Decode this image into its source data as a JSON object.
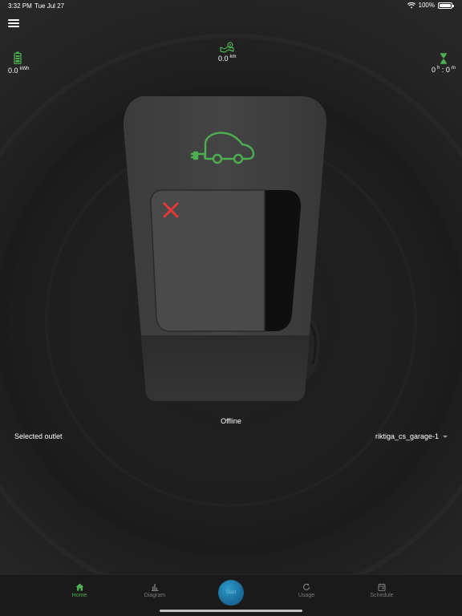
{
  "status_bar": {
    "time": "3:32 PM",
    "date": "Tue Jul 27",
    "battery_percent": "100%",
    "battery_level": 1.0
  },
  "stats": {
    "energy": {
      "value": "0.0",
      "unit": "kWh",
      "icon": "battery-icon"
    },
    "distance": {
      "value": "0.0",
      "unit": "km",
      "icon": "route-map-icon"
    },
    "time": {
      "hours": "0",
      "hours_unit": "h",
      "separator": ":",
      "minutes": "0",
      "minutes_unit": "m",
      "icon": "hourglass-icon"
    }
  },
  "charger": {
    "status": "Offline",
    "status_icon": "red-x-icon",
    "logo_icon": "ev-car-plug-icon"
  },
  "outlet": {
    "label": "Selected outlet",
    "selected": "riktiga_cs_garage-1"
  },
  "nav": {
    "home": "Home",
    "diagram": "Diagram",
    "start": "Start",
    "usage": "Usage",
    "schedule": "Schedule"
  },
  "colors": {
    "accent_green": "#4caf50",
    "error_red": "#e53935",
    "start_blue": "#1a6c9c"
  }
}
